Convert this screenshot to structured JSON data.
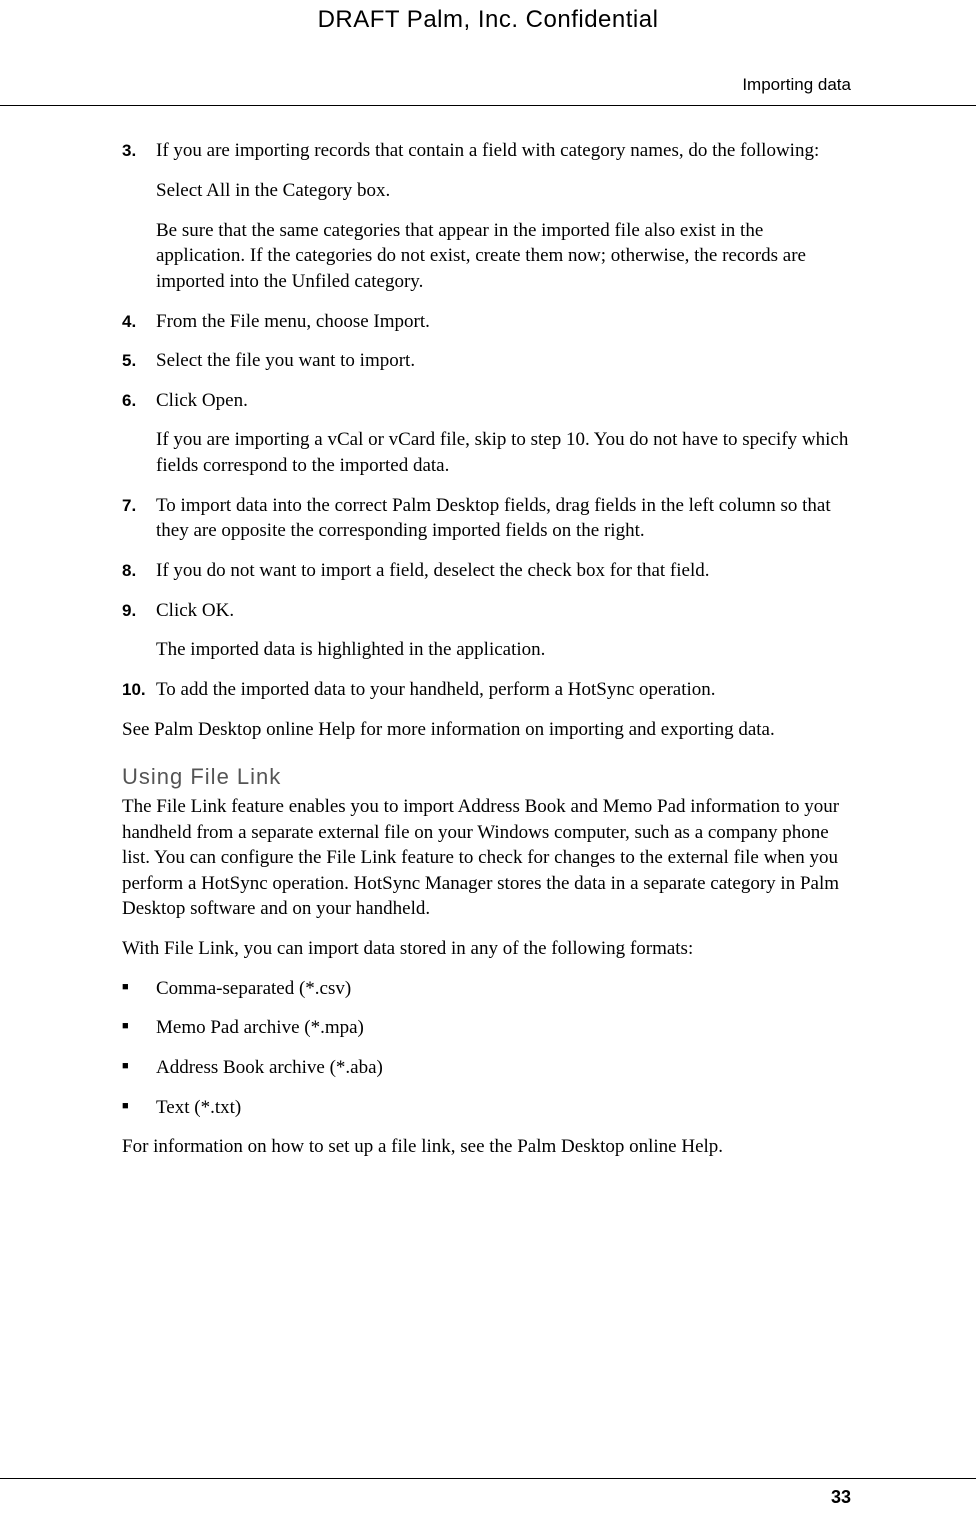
{
  "draft_header": "DRAFT   Palm, Inc. Confidential",
  "section_title": "Importing data",
  "steps": [
    {
      "num": "3.",
      "paras": [
        "If you are importing records that contain a field with category names, do the following:",
        "Select All in the Category box.",
        "Be sure that the same categories that appear in the imported file also exist in the application. If the categories do not exist, create them now; otherwise, the records are imported into the Unfiled category."
      ]
    },
    {
      "num": "4.",
      "paras": [
        "From the File menu, choose Import."
      ]
    },
    {
      "num": "5.",
      "paras": [
        "Select the file you want to import."
      ]
    },
    {
      "num": "6.",
      "paras": [
        "Click Open.",
        "If you are importing a vCal or vCard file, skip to step 10. You do not have to specify which fields correspond to the imported data."
      ]
    },
    {
      "num": "7.",
      "paras": [
        "To import data into the correct Palm Desktop fields, drag fields in the left column so that they are opposite the corresponding imported fields on the right."
      ]
    },
    {
      "num": "8.",
      "paras": [
        "If you do not want to import a field, deselect the check box for that field."
      ]
    },
    {
      "num": "9.",
      "paras": [
        "Click OK.",
        "The imported data is highlighted in the application."
      ]
    },
    {
      "num": "10.",
      "paras": [
        "To add the imported data to your handheld, perform a HotSync operation."
      ]
    }
  ],
  "after_steps": "See Palm Desktop online Help for more information on importing and exporting data.",
  "subheading": "Using File Link",
  "filelink_intro": "The File Link feature enables you to import Address Book and Memo Pad information to your handheld from a separate external file on your Windows computer, such as a company phone list. You can configure the File Link feature to check for changes to the external file when you perform a HotSync operation. HotSync Manager stores the data in a separate category in Palm Desktop software and on your handheld.",
  "filelink_formats_intro": "With File Link, you can import data stored in any of the following formats:",
  "formats": [
    "Comma-separated (*.csv)",
    "Memo Pad archive (*.mpa)",
    "Address Book archive (*.aba)",
    "Text (*.txt)"
  ],
  "filelink_outro": "For information on how to set up a file link, see the Palm Desktop online Help.",
  "page_number": "33"
}
